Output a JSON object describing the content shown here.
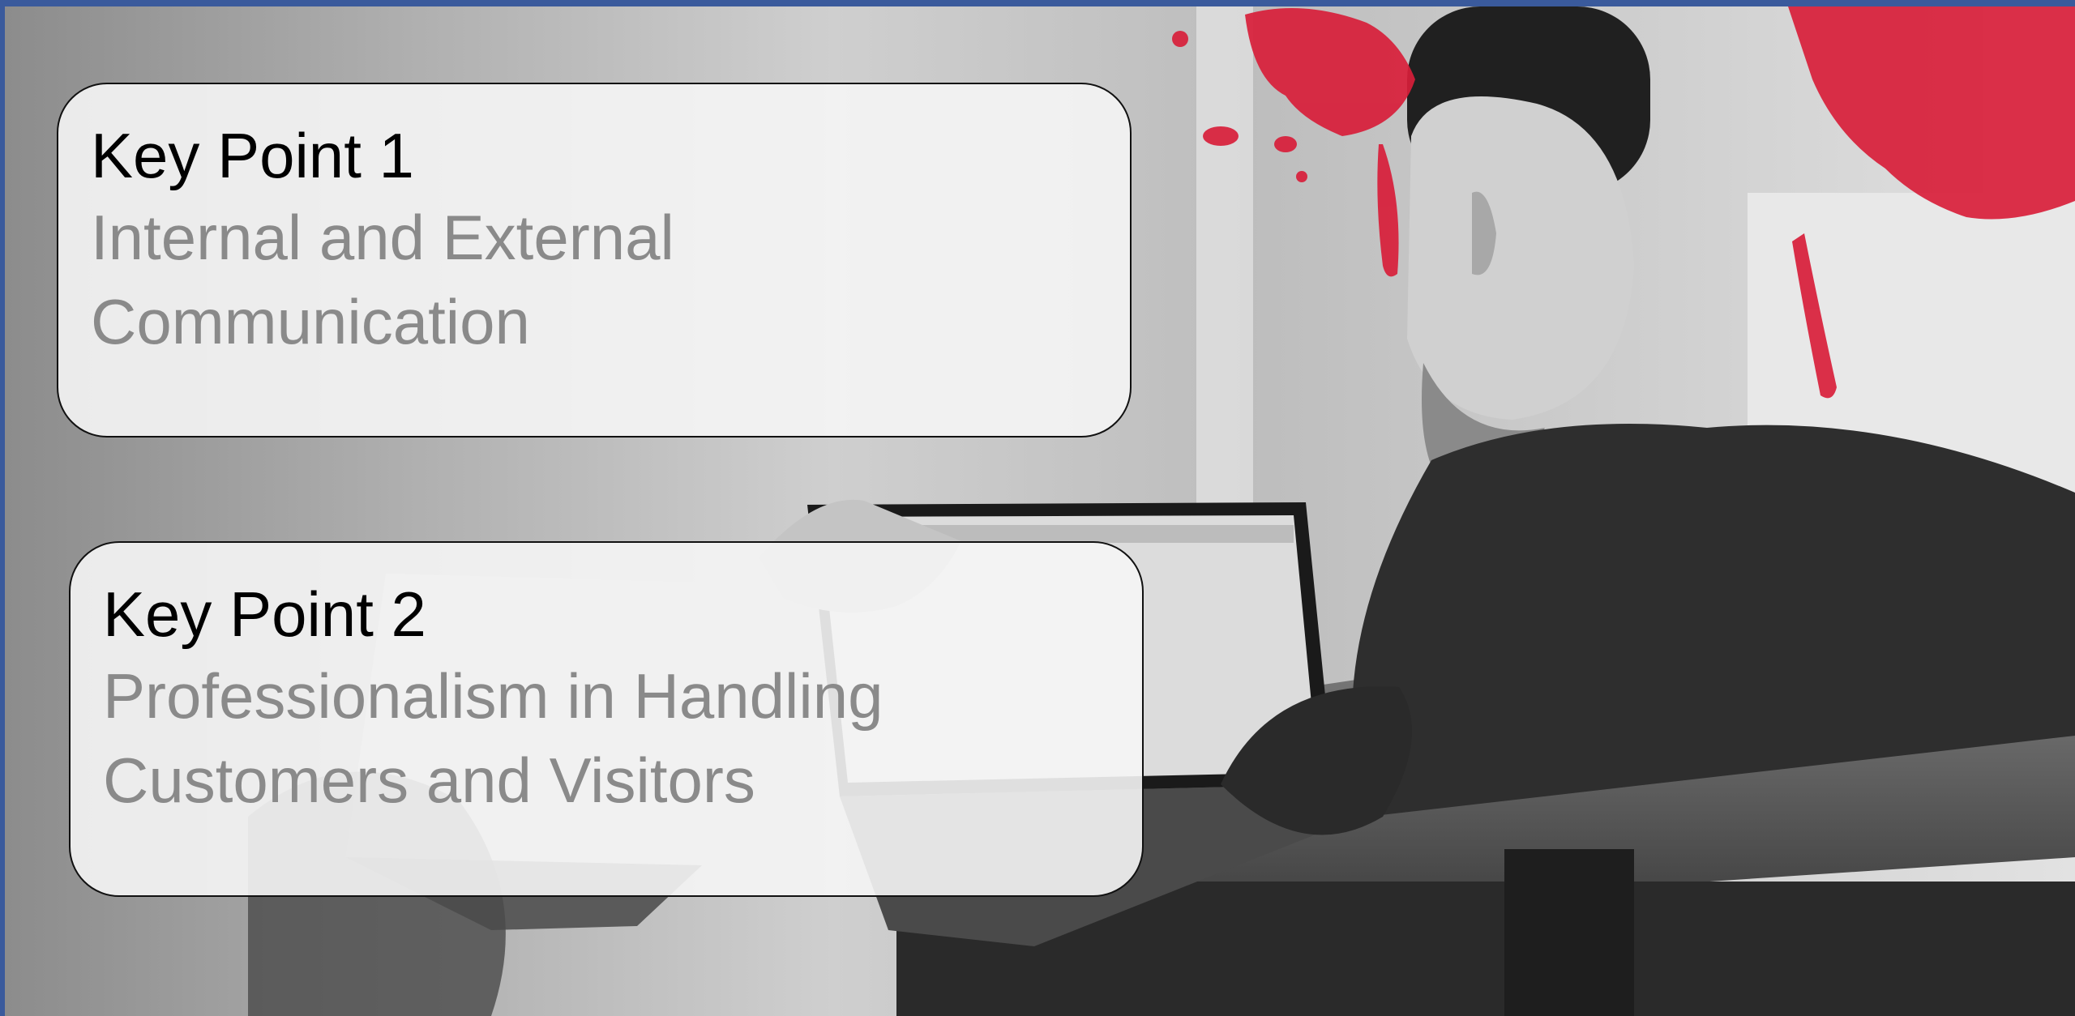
{
  "slide": {
    "accent_color": "#3a5a9c",
    "splash_color": "#d81e3a",
    "key_points": [
      {
        "title": "Key Point 1",
        "description": "Internal and External Communication"
      },
      {
        "title": "Key Point 2",
        "description": "Professionalism in Handling Customers and Visitors"
      }
    ]
  }
}
